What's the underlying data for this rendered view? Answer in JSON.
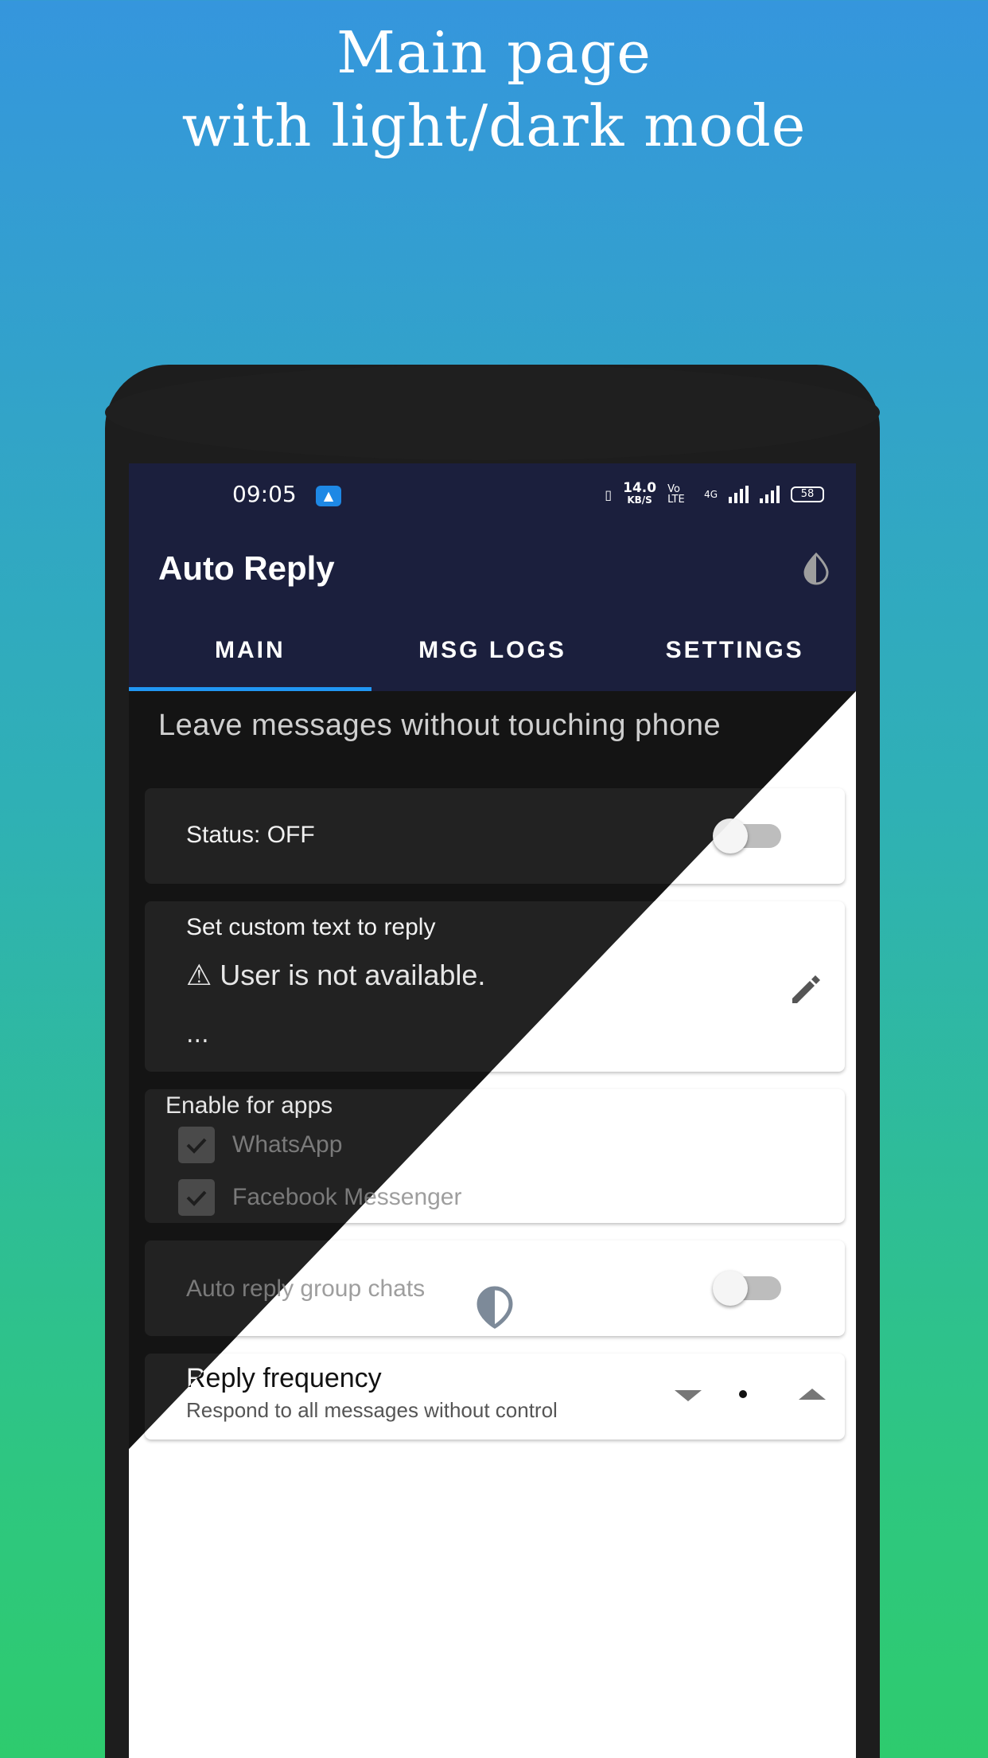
{
  "headline": {
    "line1": "Main page",
    "line2": "with light/dark mode"
  },
  "statusbar": {
    "time": "09:05",
    "speed_value": "14.0",
    "speed_unit": "KB/S",
    "volte": "Vo LTE",
    "network": "4G",
    "battery": "58"
  },
  "appbar": {
    "title": "Auto Reply",
    "theme_icon": "theme-toggle-icon"
  },
  "tabs": [
    {
      "label": "MAIN",
      "active": true
    },
    {
      "label": "MSG LOGS",
      "active": false
    },
    {
      "label": "SETTINGS",
      "active": false
    }
  ],
  "main": {
    "subtitle": "Leave messages without touching phone",
    "status_label": "Status: OFF",
    "status_on": false,
    "reply_label": "Set custom text to reply",
    "reply_text": "⚠ User is not available.",
    "reply_more": "...",
    "apps_label": "Enable for apps",
    "apps": [
      {
        "name": "WhatsApp",
        "checked": true
      },
      {
        "name": "Facebook Messenger",
        "checked": true
      }
    ],
    "group_label": "Auto reply group chats",
    "group_on": false,
    "frequency_title": "Reply frequency",
    "frequency_subtitle": "Respond to all messages without control"
  },
  "colors": {
    "appbar": "#1b1f3d",
    "tab_indicator": "#2196f3",
    "dark_bg": "#141414",
    "dark_card": "#222222"
  }
}
